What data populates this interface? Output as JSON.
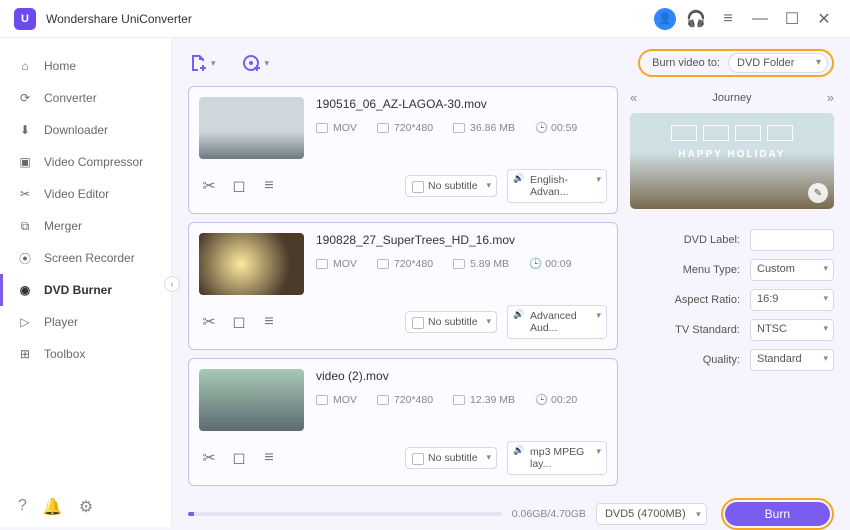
{
  "app": {
    "title": "Wondershare UniConverter"
  },
  "sidebar": {
    "items": [
      {
        "label": "Home"
      },
      {
        "label": "Converter"
      },
      {
        "label": "Downloader"
      },
      {
        "label": "Video Compressor"
      },
      {
        "label": "Video Editor"
      },
      {
        "label": "Merger"
      },
      {
        "label": "Screen Recorder"
      },
      {
        "label": "DVD Burner"
      },
      {
        "label": "Player"
      },
      {
        "label": "Toolbox"
      }
    ],
    "activeIndex": 7
  },
  "burnTo": {
    "label": "Burn video to:",
    "value": "DVD Folder"
  },
  "template": {
    "name": "Journey",
    "caption": "HAPPY HOLIDAY"
  },
  "files": [
    {
      "name": "190516_06_AZ-LAGOA-30.mov",
      "format": "MOV",
      "res": "720*480",
      "size": "36.86 MB",
      "dur": "00:59",
      "subtitle": "No subtitle",
      "audio": "English-Advan...",
      "thumb": "linear-gradient(#d0d7dc 55%, #6b7a80)"
    },
    {
      "name": "190828_27_SuperTrees_HD_16.mov",
      "format": "MOV",
      "res": "720*480",
      "size": "5.89 MB",
      "dur": "00:09",
      "subtitle": "No subtitle",
      "audio": "Advanced Aud...",
      "thumb": "radial-gradient(circle at 40% 50%, #ffeaa0, #4b3b2a 70%)"
    },
    {
      "name": "video (2).mov",
      "format": "MOV",
      "res": "720*480",
      "size": "12.39 MB",
      "dur": "00:20",
      "subtitle": "No subtitle",
      "audio": "mp3 MPEG lay...",
      "thumb": "linear-gradient(#a7c9b3, #5e6b72)"
    }
  ],
  "settings": {
    "dvdLabel_lbl": "DVD Label:",
    "dvdLabel": "",
    "menuType_lbl": "Menu Type:",
    "menuType": "Custom",
    "aspect_lbl": "Aspect Ratio:",
    "aspect": "16:9",
    "tv_lbl": "TV Standard:",
    "tv": "NTSC",
    "quality_lbl": "Quality:",
    "quality": "Standard"
  },
  "footer": {
    "progressText": "0.06GB/4.70GB",
    "disk": "DVD5 (4700MB)",
    "burn": "Burn"
  }
}
